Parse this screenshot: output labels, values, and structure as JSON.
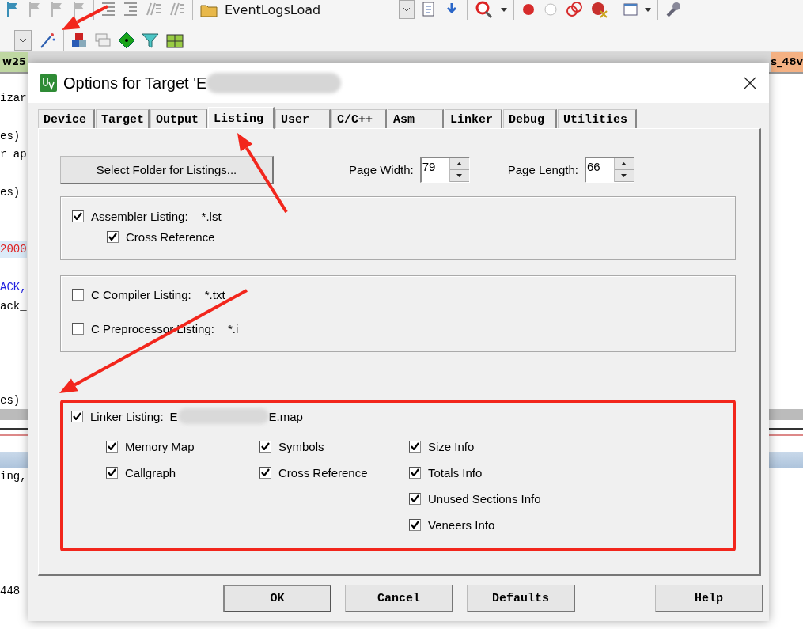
{
  "toolbar": {
    "configuration": "EventLogsLoad"
  },
  "file_tabs": [
    {
      "label": "w25",
      "kind": "left"
    },
    {
      "label": "s_48v",
      "kind": "right"
    }
  ],
  "code_lines": [
    {
      "text": "izar",
      "kind": "plain"
    },
    {
      "text": "es)",
      "kind": "plain"
    },
    {
      "text": "r ap",
      "kind": "plain"
    },
    {
      "text": "es)",
      "kind": "plain"
    },
    {
      "text": "2000",
      "kind": "number"
    },
    {
      "text": "ACK,",
      "kind": "keyword"
    },
    {
      "text": "ack_",
      "kind": "plain"
    },
    {
      "text": "es)",
      "kind": "plain"
    },
    {
      "text": "ing,",
      "kind": "plain"
    },
    {
      "text": "448",
      "kind": "plain"
    }
  ],
  "dialog": {
    "title": "Options for Target 'E",
    "tabs": [
      {
        "label": "Device",
        "selected": false
      },
      {
        "label": "Target",
        "selected": false
      },
      {
        "label": "Output",
        "selected": false
      },
      {
        "label": "Listing",
        "selected": true
      },
      {
        "label": "User",
        "selected": false
      },
      {
        "label": "C/C++",
        "selected": false
      },
      {
        "label": "Asm",
        "selected": false
      },
      {
        "label": "Linker",
        "selected": false
      },
      {
        "label": "Debug",
        "selected": false
      },
      {
        "label": "Utilities",
        "selected": false
      }
    ],
    "select_folder_button": "Select Folder for Listings...",
    "page_width": {
      "label": "Page Width:",
      "value": "79"
    },
    "page_length": {
      "label": "Page Length:",
      "value": "66"
    },
    "assembler_listing": {
      "label": "Assembler Listing:",
      "pattern": "*.lst",
      "checked": true
    },
    "assembler_cross_reference": {
      "label": "Cross Reference",
      "checked": true
    },
    "c_compiler_listing": {
      "label": "C Compiler Listing:",
      "pattern": "*.txt",
      "checked": false
    },
    "c_preprocessor_listing": {
      "label": "C Preprocessor Listing:",
      "pattern": "*.i",
      "checked": false
    },
    "linker_listing": {
      "label": "Linker Listing:",
      "path_start": "E",
      "path_end": "E.map",
      "checked": true,
      "highlighted": true
    },
    "linker_options": [
      {
        "items": [
          {
            "label": "Memory Map",
            "checked": true
          },
          {
            "label": "Callgraph",
            "checked": true
          }
        ]
      },
      {
        "items": [
          {
            "label": "Symbols",
            "checked": true
          },
          {
            "label": "Cross Reference",
            "checked": true
          }
        ]
      },
      {
        "items": [
          {
            "label": "Size Info",
            "checked": true
          },
          {
            "label": "Totals Info",
            "checked": true
          },
          {
            "label": "Unused Sections Info",
            "checked": true
          },
          {
            "label": "Veneers Info",
            "checked": true
          }
        ]
      }
    ],
    "buttons": [
      {
        "label": "OK",
        "default": true
      },
      {
        "label": "Cancel",
        "default": false
      },
      {
        "label": "Defaults",
        "default": false
      },
      {
        "label": "Help",
        "default": false
      }
    ]
  }
}
